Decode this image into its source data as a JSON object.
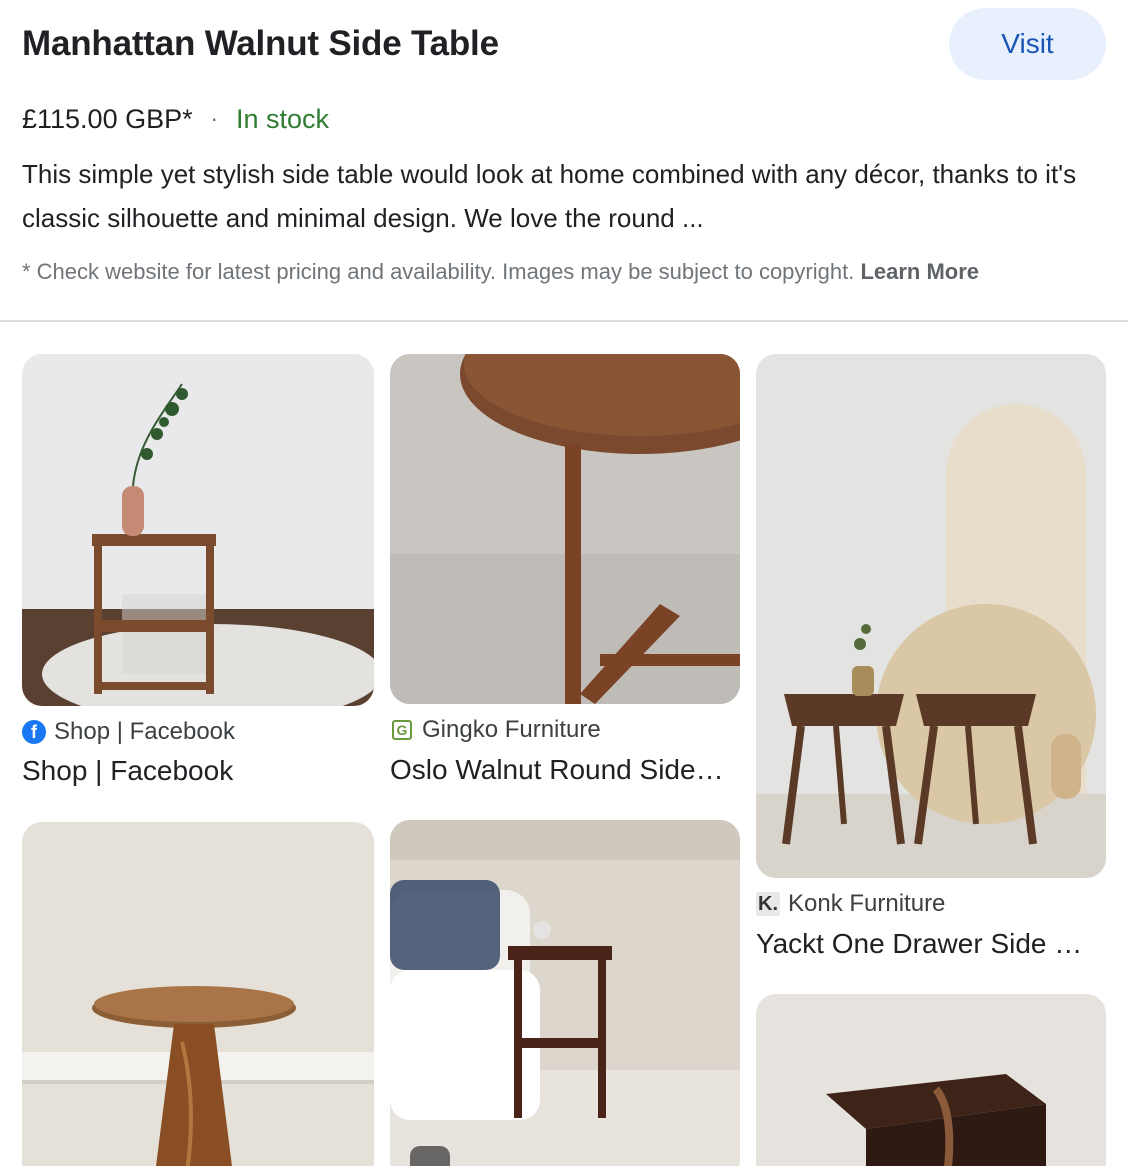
{
  "header": {
    "title": "Manhattan Walnut Side Table",
    "visit_label": "Visit"
  },
  "offer": {
    "price": "£115.00 GBP*",
    "separator": "·",
    "availability": "In stock",
    "availability_color": "#2e7d32"
  },
  "description": "This simple yet stylish side table would look at home combined with any décor, thanks to it's classic silhouette and minimal design. We love the round ...",
  "disclaimer": {
    "text": "* Check website for latest pricing and availability. Images may be subject to copyright.",
    "link": "Learn More"
  },
  "results": [
    {
      "source": "Shop | Facebook",
      "title": "Shop | Facebook",
      "icon": "facebook-icon"
    },
    {
      "source": "Gingko Furniture",
      "title": "Oslo Walnut Round Side…",
      "icon": "gingko-icon"
    },
    {
      "source": "Konk Furniture",
      "title": "Yackt One Drawer Side …",
      "icon": "konk-icon",
      "icon_glyph": "K."
    },
    {
      "title": "",
      "source": ""
    },
    {
      "title": "",
      "source": "",
      "icon": "tag-icon"
    },
    {
      "title": "",
      "source": ""
    }
  ],
  "colors": {
    "visit_bg": "#e8f0fe",
    "visit_text": "#1a56b3",
    "facebook_blue": "#1877f2"
  }
}
